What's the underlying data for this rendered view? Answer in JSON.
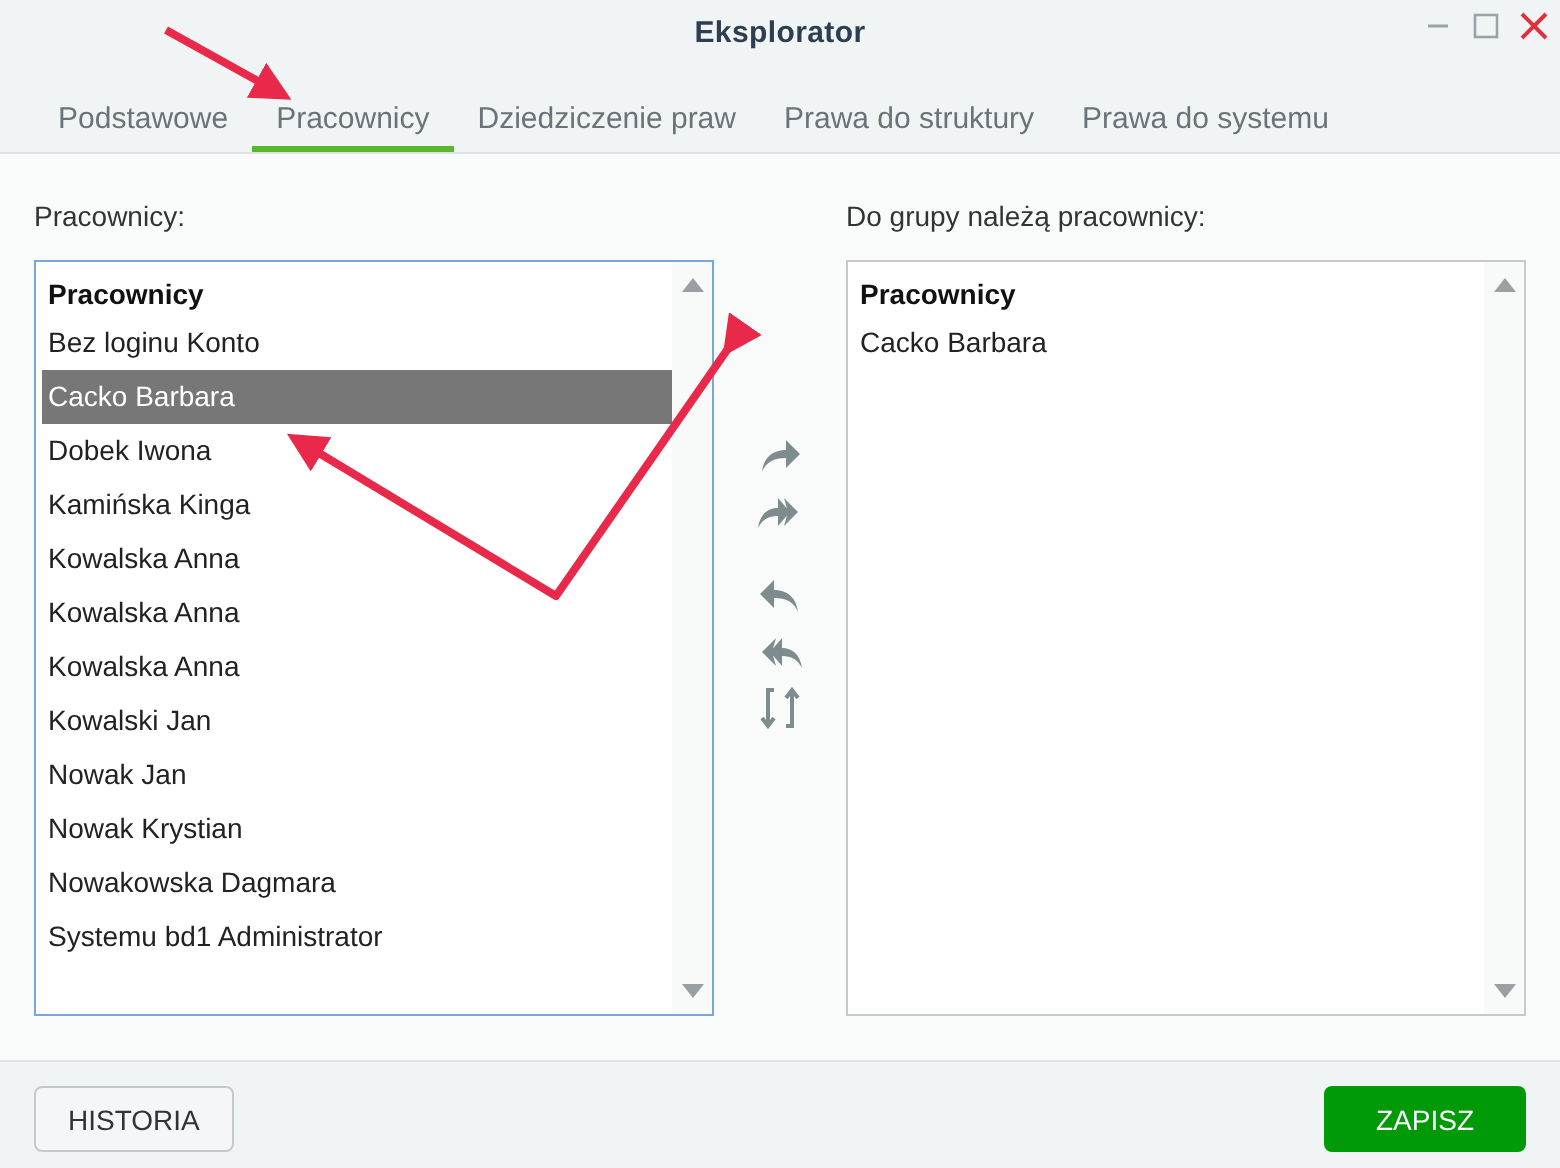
{
  "window": {
    "title": "Eksplorator"
  },
  "tabs": [
    {
      "label": "Podstawowe",
      "selected": false
    },
    {
      "label": "Pracownicy",
      "selected": true
    },
    {
      "label": "Dziedziczenie praw",
      "selected": false
    },
    {
      "label": "Prawa do struktury",
      "selected": false
    },
    {
      "label": "Prawa do systemu",
      "selected": false
    }
  ],
  "available_list": {
    "label": "Pracownicy:",
    "header": "Pracownicy",
    "focused": true,
    "items": [
      {
        "text": "Bez loginu Konto",
        "selected": false
      },
      {
        "text": "Cacko Barbara",
        "selected": true
      },
      {
        "text": "Dobek Iwona",
        "selected": false
      },
      {
        "text": "Kamińska Kinga",
        "selected": false
      },
      {
        "text": "Kowalska Anna",
        "selected": false
      },
      {
        "text": "Kowalska Anna",
        "selected": false
      },
      {
        "text": "Kowalska Anna",
        "selected": false
      },
      {
        "text": "Kowalski Jan",
        "selected": false
      },
      {
        "text": "Nowak Jan",
        "selected": false
      },
      {
        "text": "Nowak Krystian",
        "selected": false
      },
      {
        "text": "Nowakowska Dagmara",
        "selected": false
      },
      {
        "text": "Systemu bd1 Administrator",
        "selected": false
      }
    ]
  },
  "member_list": {
    "label": "Do grupy należą pracownicy:",
    "header": "Pracownicy",
    "focused": false,
    "items": [
      {
        "text": "Cacko Barbara",
        "selected": false
      }
    ]
  },
  "buttons": [
    {
      "label": "HISTORIA",
      "kind": "secondary"
    },
    {
      "label": "ZAPISZ",
      "kind": "primary"
    }
  ]
}
